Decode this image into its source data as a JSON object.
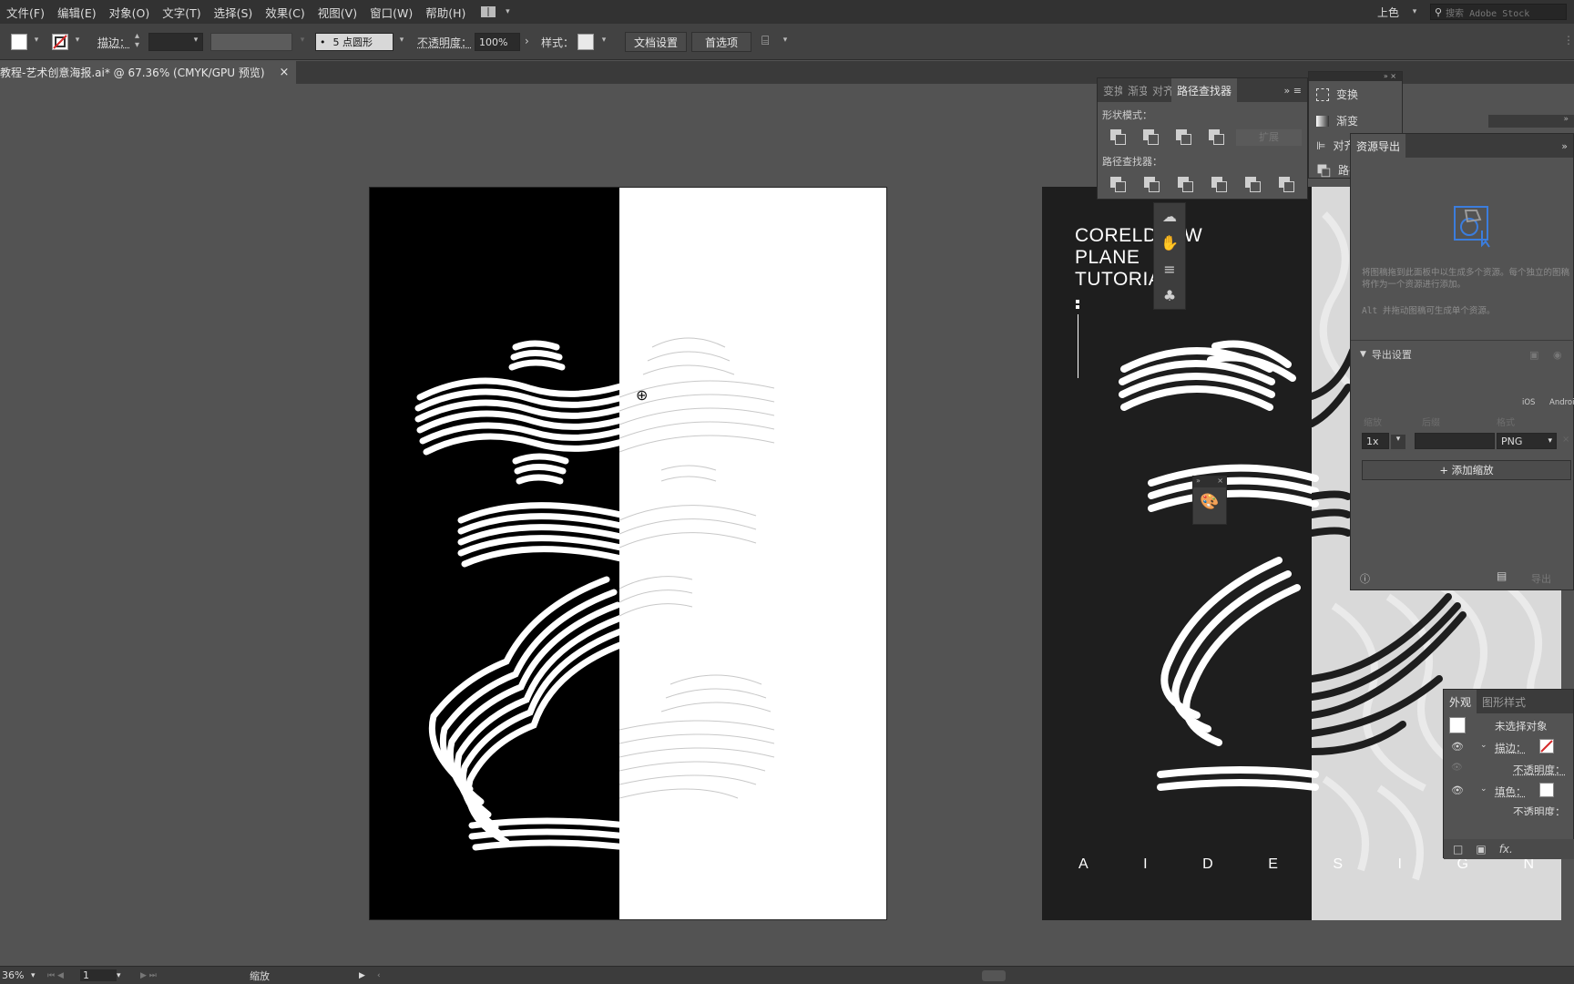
{
  "menu": {
    "items": [
      "文件(F)",
      "编辑(E)",
      "对象(O)",
      "文字(T)",
      "选择(S)",
      "效果(C)",
      "视图(V)",
      "窗口(W)",
      "帮助(H)"
    ],
    "workspace": "上色",
    "search_placeholder": "搜索 Adobe Stock"
  },
  "control": {
    "stroke_label": "描边：",
    "brush": "5 点圆形",
    "opacity_label": "不透明度：",
    "opacity_value": "100%",
    "style_label": "样式：",
    "doc_setup": "文档设置",
    "preferences": "首选项"
  },
  "document_tab": {
    "title": "教程-艺术创意海报.ai* @ 67.36% (CMYK/GPU 预览)",
    "close": "×"
  },
  "artboard2": {
    "title_lines": [
      "CORELDRAW",
      "PLANE",
      "TUTORIAL"
    ],
    "letters": [
      "A",
      "I",
      "D",
      "E",
      "S",
      "I",
      "G",
      "N"
    ]
  },
  "pathfinder": {
    "tabs": [
      "变换",
      "渐变",
      "对齐",
      "路径查找器"
    ],
    "shape_modes_label": "形状模式：",
    "expand": "扩展",
    "pathfinders_label": "路径查找器："
  },
  "dock_small": {
    "items": [
      "变换",
      "渐变",
      "对齐",
      "路径"
    ]
  },
  "asset_export": {
    "title": "资源导出",
    "hint": "将图稿拖到此面板中以生成多个资源。每个独立的图稿将作为一个资源进行添加。",
    "hint2": "Alt 并拖动图稿可生成单个资源。",
    "export_settings": "导出设置",
    "ios": "iOS",
    "android": "Android",
    "scale_label": "缩放",
    "suffix_label": "后缀",
    "format_label": "格式",
    "scale_value": "1x",
    "format_value": "PNG",
    "add_scale": "+ 添加缩放",
    "export_btn": "导出"
  },
  "appearance": {
    "tabs": [
      "外观",
      "图形样式"
    ],
    "no_selection": "未选择对象",
    "stroke": "描边：",
    "opacity": "不透明度：",
    "fill": "填色：",
    "opacity2": "不透明度：",
    "fx": "fx."
  },
  "status": {
    "zoom": "36%",
    "page": "1",
    "tool": "缩放"
  },
  "colors": {
    "menubar": "#323232",
    "canvas": "#535353",
    "panel": "#535353",
    "accent_red": "#d42b2b",
    "export_icon": "#3b7ddd"
  }
}
